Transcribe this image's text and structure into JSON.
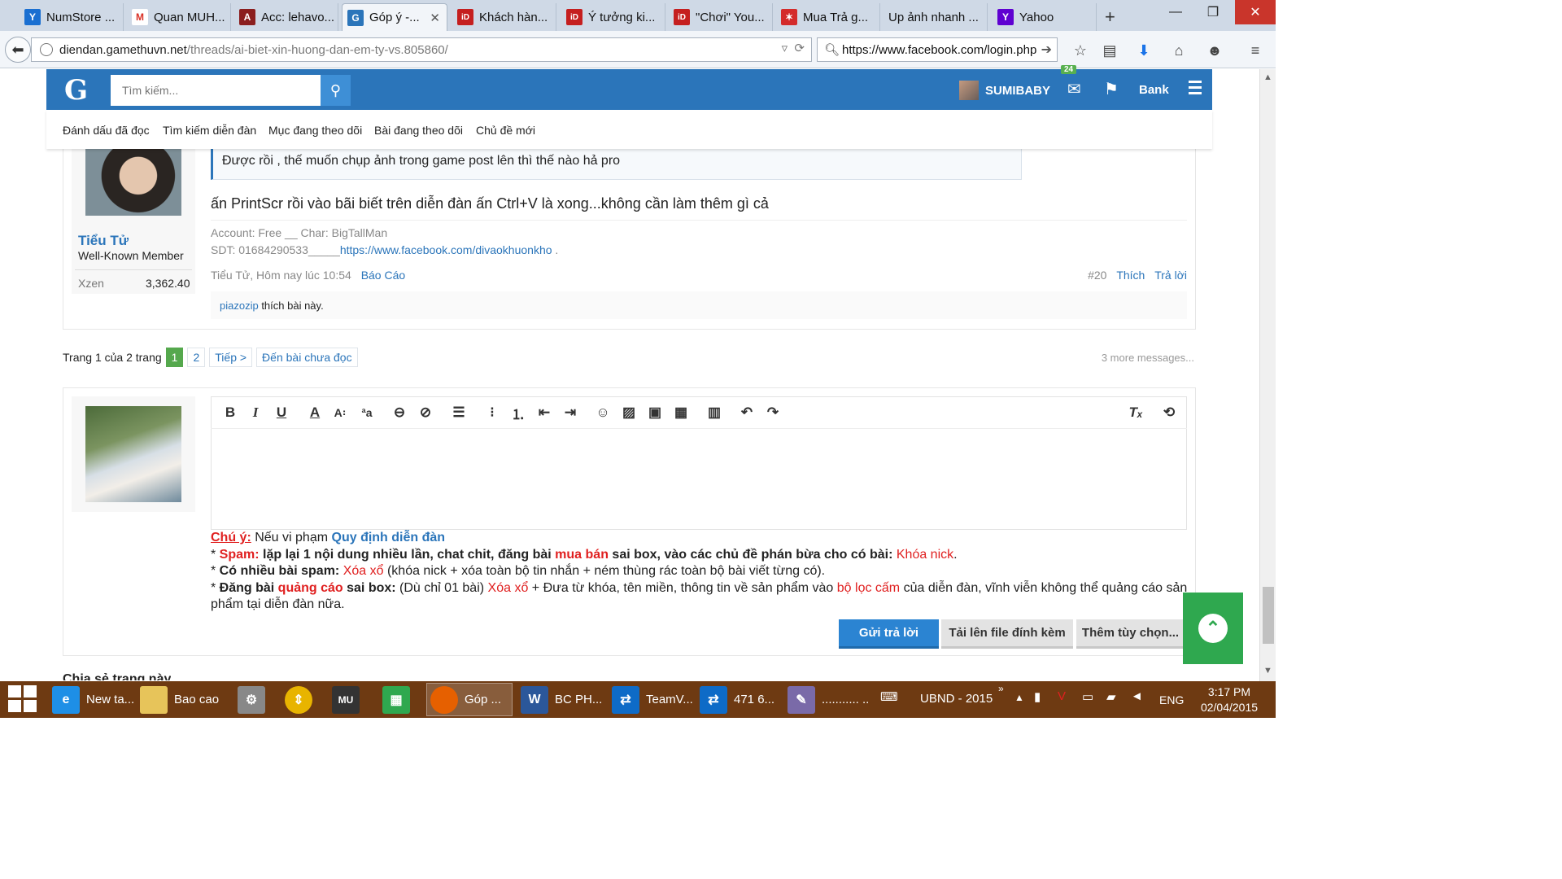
{
  "browser": {
    "tabs": [
      {
        "label": "NumStore ...",
        "icon": "numstore-icon",
        "color": "#1a6fd1"
      },
      {
        "label": "Quan MUH...",
        "icon": "gmail-icon",
        "color": "#d93025"
      },
      {
        "label": "Acc: lehavo...",
        "icon": "game-icon",
        "color": "#8b1e1e"
      },
      {
        "label": "Góp ý -...",
        "icon": "gamethu-icon",
        "color": "#2b75ba"
      },
      {
        "label": "Khách hàn...",
        "icon": "id-icon",
        "color": "#c51f1f"
      },
      {
        "label": "Ý tưởng ki...",
        "icon": "id-icon",
        "color": "#c51f1f"
      },
      {
        "label": "\"Chơi\" You...",
        "icon": "id-icon",
        "color": "#c51f1f"
      },
      {
        "label": "Mua Trả g...",
        "icon": "star-icon",
        "color": "#d42b2b"
      },
      {
        "label": "Up ảnh nhanh ...",
        "icon": "blank-icon",
        "color": "#cfd9e6"
      },
      {
        "label": "Yahoo",
        "icon": "yahoo-icon",
        "color": "#5f01d1"
      }
    ],
    "url_domain": "diendan.gamethuvn.net",
    "url_path": "/threads/ai-biet-xin-huong-dan-em-ty-vs.805860/",
    "search_value": "https://www.facebook.com/login.php"
  },
  "site": {
    "logo": "G",
    "search_placeholder": "Tìm kiếm...",
    "username": "SUMIBABY",
    "alert_count": "24",
    "bank_label": "Bank",
    "nav": [
      "Đánh dấu đã đọc",
      "Tìm kiếm diễn đàn",
      "Mục đang theo dõi",
      "Bài đang theo dõi",
      "Chủ đề mới"
    ]
  },
  "post": {
    "author": "Tiểu Tử",
    "role": "Well-Known Member",
    "xzen_label": "Xzen",
    "xzen_value": "3,362.40",
    "quote": "Được rồi , thế muốn chụp ảnh trong game post lên thì thế nào hả pro",
    "body": "ấn PrintScr rồi vào bãi biết trên diễn đàn ấn Ctrl+V là xong...không cần làm thêm gì cả",
    "sig_line1": "Account: Free __ Char: BigTallMan",
    "sig_line2_prefix": "SDT: 01684290533_____",
    "sig_link": "https://www.facebook.com/divaokhuonkho",
    "sig_suffix": " .",
    "meta": "Tiểu Tử, Hôm nay lúc 10:54",
    "report": "Báo Cáo",
    "number": "#20",
    "like": "Thích",
    "reply": "Trả lời",
    "liker": "piazozip",
    "likes_text": " thích bài này."
  },
  "pagination": {
    "label": "Trang 1 của 2 trang",
    "pages": [
      "1",
      "2"
    ],
    "next": "Tiếp >",
    "unread": "Đến bài chưa đọc",
    "more": "3 more messages..."
  },
  "rules": {
    "note_label": "Chú ý:",
    "note_text": " Nếu vi phạm ",
    "note_link": "Quy định diễn đàn",
    "l1_a": "* ",
    "l1_b": "Spam:",
    "l1_c": " lặp lại 1 nội dung nhiều lần, chat chit, đăng bài ",
    "l1_d": "mua bán",
    "l1_e": " sai box, vào các chủ đề phán bừa cho có bài:",
    "l1_f": " Khóa nick",
    "l1_g": ".",
    "l2_a": "* ",
    "l2_b": "Có nhiều bài spam:",
    "l2_c": " Xóa xổ",
    "l2_d": " (khóa nick + xóa toàn bộ tin nhắn + ném thùng rác toàn bộ bài viết từng có).",
    "l3_a": "* ",
    "l3_b": "Đăng bài",
    "l3_c": " quảng cáo",
    "l3_d": " sai box:",
    "l3_e": " (Dù chỉ 01 bài) ",
    "l3_f": "Xóa xổ",
    "l3_g": " + Đưa từ khóa, tên miền, thông tin về sản phẩm vào ",
    "l3_h": "bộ lọc cấm",
    "l3_i": " của diễn đàn, vĩnh viễn không thể quảng cáo sản phẩm tại diễn đàn nữa."
  },
  "buttons": {
    "submit": "Gửi trả lời",
    "upload": "Tải lên file đính kèm",
    "more": "Thêm tùy chọn..."
  },
  "partial_heading": "Chia sẻ trang này",
  "taskbar": {
    "items": [
      {
        "label": "New ta...",
        "icon": "ie-icon",
        "color": "#1e8fe6"
      },
      {
        "label": "Bao cao",
        "icon": "folder-icon",
        "color": "#e7c45a"
      },
      {
        "label": "",
        "icon": "tool-icon",
        "color": "#888888"
      },
      {
        "label": "",
        "icon": "updater-icon",
        "color": "#e8b400"
      },
      {
        "label": "",
        "icon": "mu-game-icon",
        "color": "#333333"
      },
      {
        "label": "",
        "icon": "store-icon",
        "color": "#2fa84f"
      },
      {
        "label": "Góp ...",
        "icon": "firefox-icon",
        "color": "#e66000"
      },
      {
        "label": "BC PH...",
        "icon": "word-icon",
        "color": "#2b579a"
      },
      {
        "label": "TeamV...",
        "icon": "teamviewer-icon",
        "color": "#0e6bc7"
      },
      {
        "label": "471 6...",
        "icon": "teamviewer-icon",
        "color": "#0e6bc7"
      },
      {
        "label": "........... ...",
        "icon": "paint-icon",
        "color": "#7a6aa8"
      }
    ],
    "keyboard_label": "UBND - 2015",
    "lang": "ENG",
    "time": "3:17 PM",
    "date": "02/04/2015"
  }
}
